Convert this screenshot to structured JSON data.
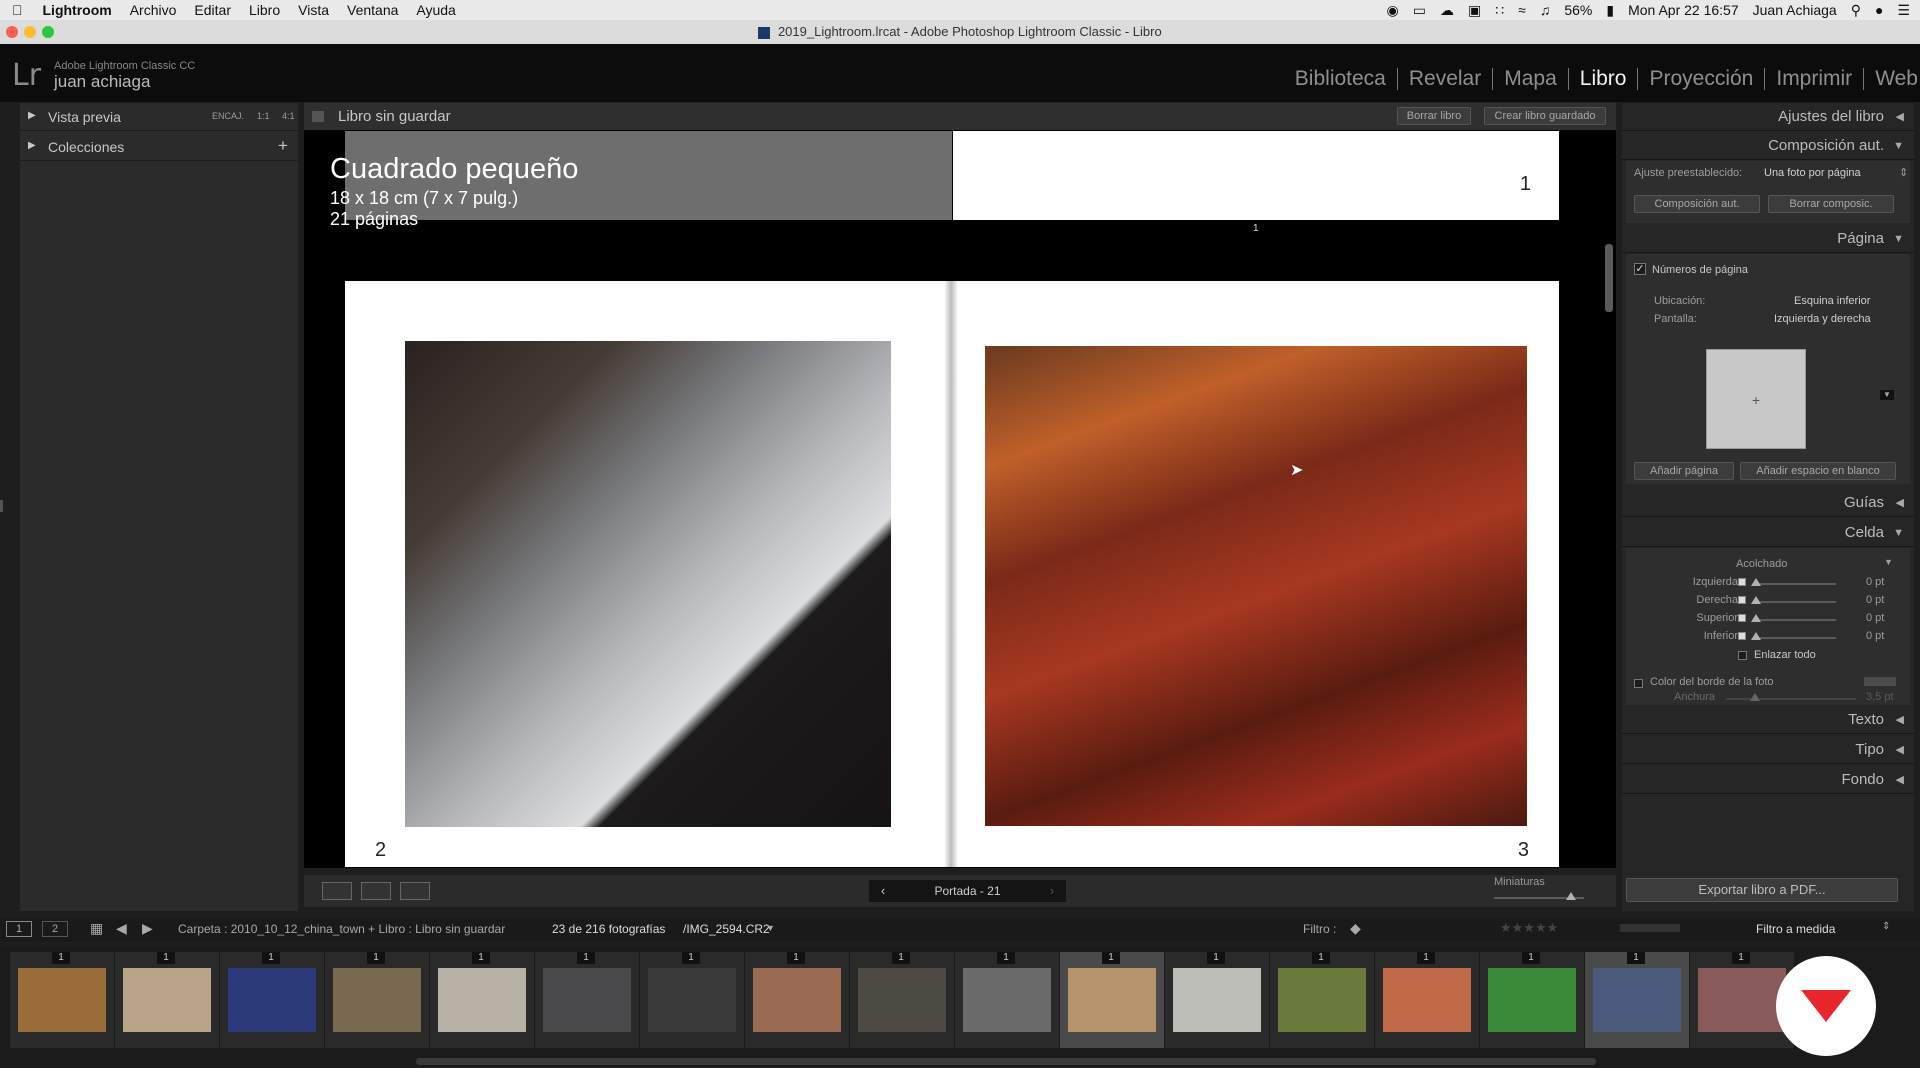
{
  "menubar": {
    "apple": "",
    "app": "Lightroom",
    "items": [
      "Archivo",
      "Editar",
      "Libro",
      "Vista",
      "Ventana",
      "Ayuda"
    ],
    "battery": "56%",
    "clock": "Mon Apr 22  16:57",
    "user": "Juan Achiaga"
  },
  "window": {
    "title": "2019_Lightroom.lrcat - Adobe Photoshop Lightroom Classic - Libro"
  },
  "identity": {
    "logo": "Lr",
    "app_name": "Adobe Lightroom Classic CC",
    "user_name": "juan achiaga"
  },
  "modules": [
    "Biblioteca",
    "Revelar",
    "Mapa",
    "Libro",
    "Proyección",
    "Imprimir",
    "Web"
  ],
  "active_module": "Libro",
  "left_panel": {
    "preview": {
      "label": "Vista previa",
      "zoom_options": [
        "ENCAJ.",
        "1:1",
        "4:1"
      ]
    },
    "collections": {
      "label": "Colecciones",
      "add": "+"
    }
  },
  "center": {
    "book_title": "Libro sin guardar",
    "clear_book": "Borrar libro",
    "create_saved": "Crear libro guardado",
    "book_format": "Cuadrado pequeño",
    "book_size": "18 x 18 cm (7 x 7 pulg.)",
    "book_pages": "21 páginas",
    "cover_page_number": "1",
    "cover_small_number": "1",
    "left_page_number": "2",
    "right_page_number": "3"
  },
  "toolbar": {
    "nav_label": "Portada - 21",
    "thumbs_label": "Miniaturas",
    "thumb_size": 0.85
  },
  "right_panel": {
    "book_settings": "Ajustes del libro",
    "auto_layout": {
      "title": "Composición aut.",
      "preset_label": "Ajuste preestablecido:",
      "preset_value": "Una foto por página",
      "auto_btn": "Composición aut.",
      "clear_btn": "Borrar composic."
    },
    "page": {
      "title": "Página",
      "page_numbers": "Números de página",
      "location_label": "Ubicación:",
      "location_value": "Esquina inferior",
      "display_label": "Pantalla:",
      "display_value": "Izquierda y derecha",
      "add_page": "Añadir página",
      "add_blank": "Añadir espacio en blanco"
    },
    "guides": "Guías",
    "cell": {
      "title": "Celda",
      "padding": "Acolchado",
      "rows": [
        {
          "label": "Izquierda",
          "value": "0 pt"
        },
        {
          "label": "Derecha",
          "value": "0 pt"
        },
        {
          "label": "Superior",
          "value": "0 pt"
        },
        {
          "label": "Inferior",
          "value": "0 pt"
        }
      ],
      "link_all": "Enlazar todo",
      "border_color": "Color del borde de la foto",
      "width_label": "Anchura",
      "width_value": "3,5 pt"
    },
    "text": "Texto",
    "type": "Tipo",
    "background": "Fondo",
    "export": "Exportar libro a PDF..."
  },
  "filmbar": {
    "screen1": "1",
    "screen2": "2",
    "path": "Carpeta : 2010_10_12_china_town  +  Libro : Libro sin guardar",
    "count": "23 de 216 fotografías",
    "file": "/IMG_2594.CR2",
    "filter_label": "Filtro :",
    "filter_value": "Filtro a medida"
  },
  "filmstrip": {
    "thumbs": [
      {
        "n": "1",
        "c": "#9a6c3a"
      },
      {
        "n": "1",
        "c": "#b9a48a"
      },
      {
        "n": "1",
        "c": "#2c3a7a"
      },
      {
        "n": "1",
        "c": "#7a6a52"
      },
      {
        "n": "1",
        "c": "#b8b2a6"
      },
      {
        "n": "1",
        "c": "#4a4a4c"
      },
      {
        "n": "1",
        "c": "#3a3a3a"
      },
      {
        "n": "1",
        "c": "#9a6a52"
      },
      {
        "n": "1",
        "c": "#4e4a44"
      },
      {
        "n": "1",
        "c": "#6a6a6a"
      },
      {
        "n": "1",
        "c": "#b8946c"
      },
      {
        "n": "1",
        "c": "#bdbdb8"
      },
      {
        "n": "1",
        "c": "#6a7a3a"
      },
      {
        "n": "1",
        "c": "#c06a4a"
      },
      {
        "n": "1",
        "c": "#3a8a3a"
      },
      {
        "n": "1",
        "c": "#4a5a7a"
      },
      {
        "n": "1",
        "c": "#8a5a5a"
      }
    ]
  },
  "colors": {
    "accent": "#f2f2f2",
    "panel": "#262626",
    "brand_badge": "#e8272d"
  }
}
